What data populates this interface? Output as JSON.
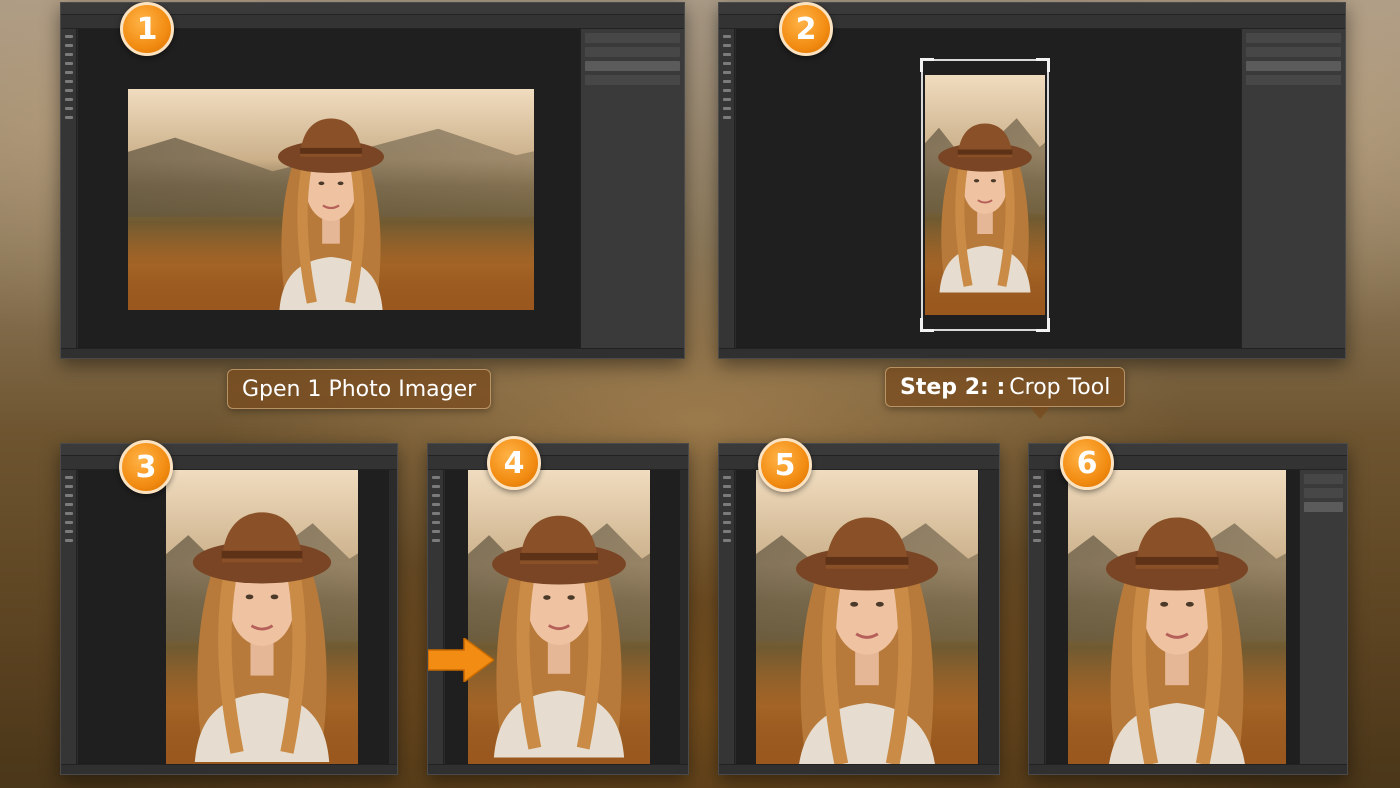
{
  "steps": [
    {
      "number": "1"
    },
    {
      "number": "2"
    },
    {
      "number": "3"
    },
    {
      "number": "4"
    },
    {
      "number": "5"
    },
    {
      "number": "6"
    }
  ],
  "labels": {
    "step1": "Gpen 1 Photo Imager",
    "step2_bold": "Step 2: :",
    "step2_rest": "Crop Tool"
  },
  "colors": {
    "badge": "#f28c12",
    "arrow": "#f28c12",
    "app_chrome": "#2b2b2b"
  },
  "icons": [
    "orange-arrow-icon"
  ]
}
